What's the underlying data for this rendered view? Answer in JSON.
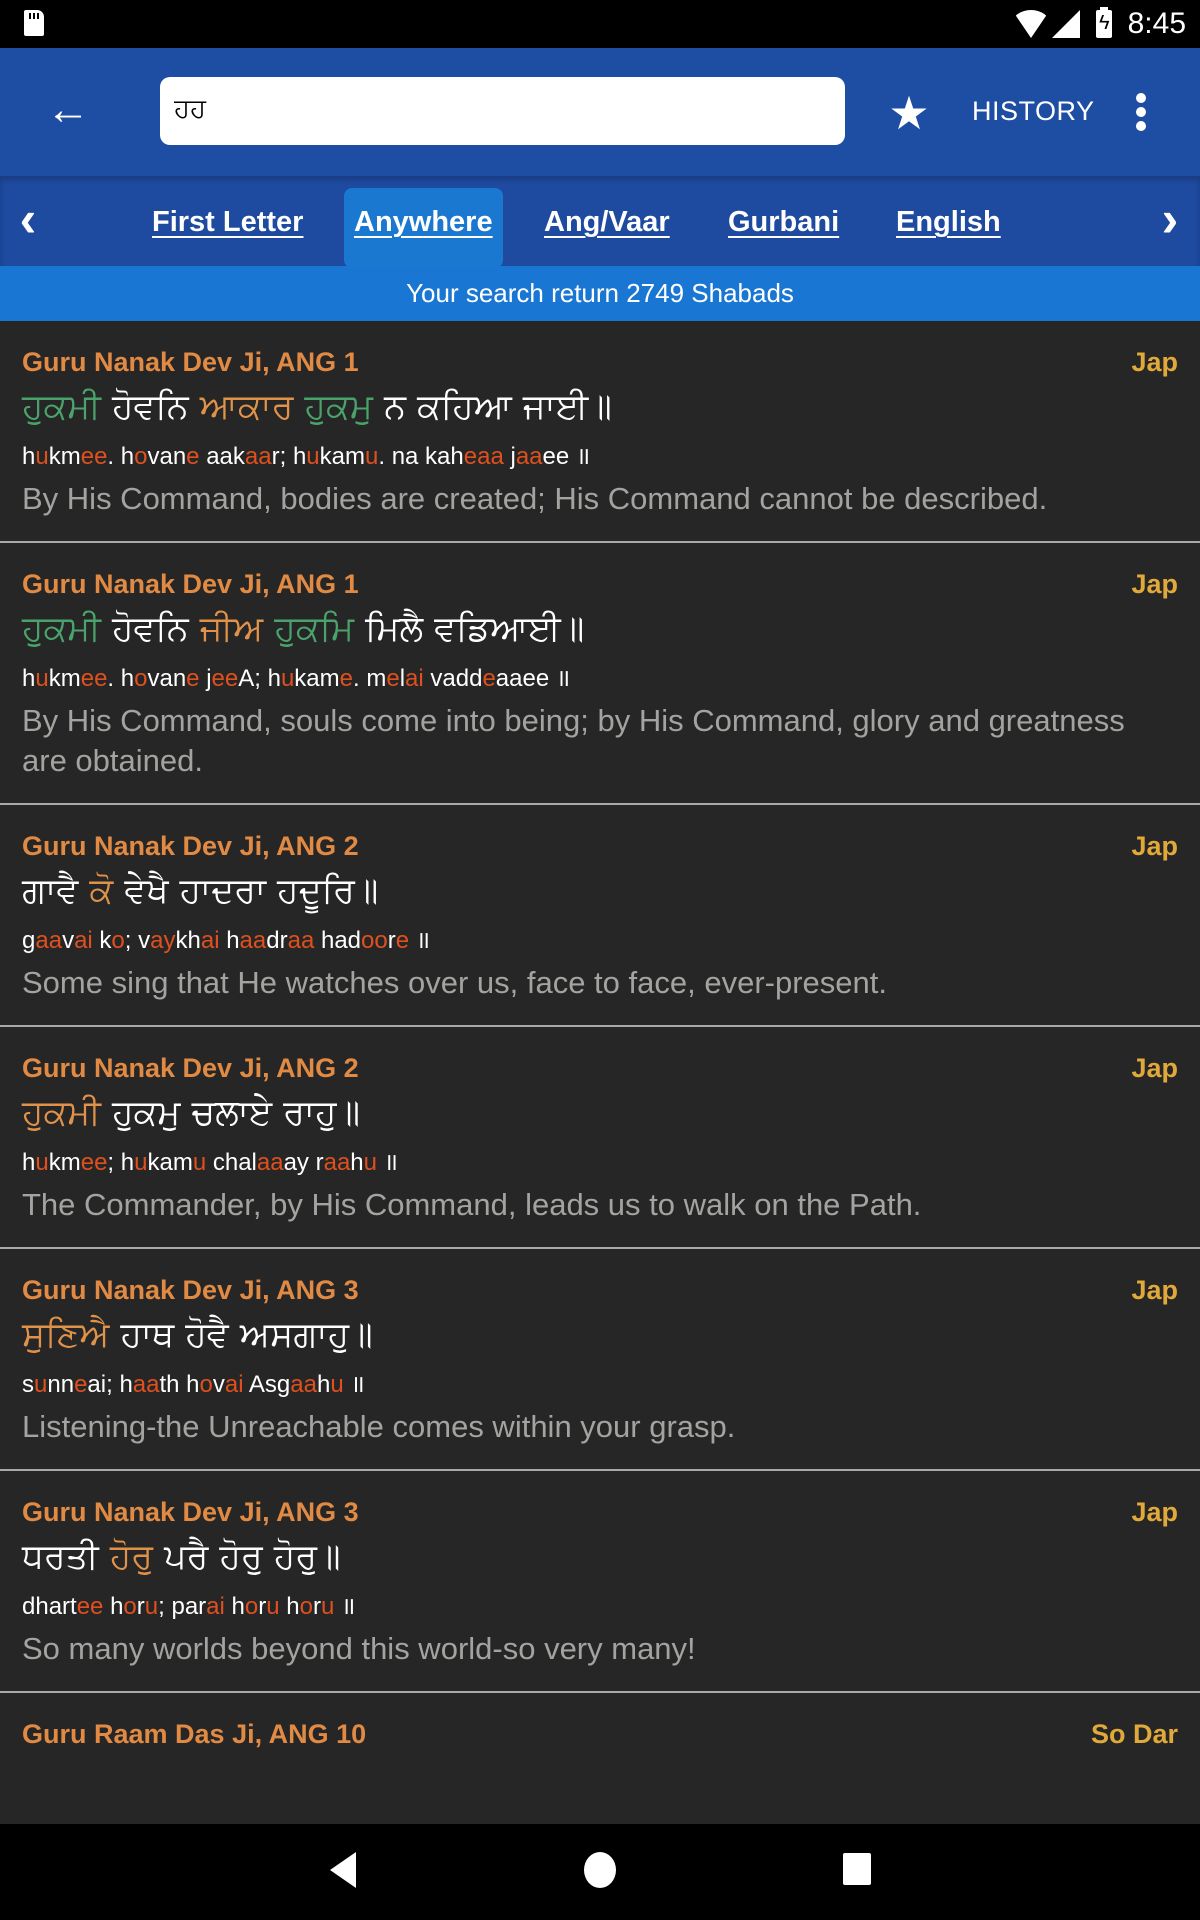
{
  "status_bar": {
    "time": "8:45",
    "icons": [
      "sd-card-icon",
      "wifi-icon",
      "signal-icon",
      "battery-charging-icon"
    ]
  },
  "toolbar": {
    "back_icon": "arrow-left-icon",
    "search_value": "ਹਹ",
    "search_placeholder": "",
    "favorite_icon": "star-icon",
    "history_label": "HISTORY",
    "more_icon": "more-vert-icon"
  },
  "tabs": {
    "prev_icon": "chevron-left-icon",
    "next_icon": "chevron-right-icon",
    "items": [
      {
        "label": "First Letter",
        "active": false
      },
      {
        "label": "Anywhere",
        "active": true
      },
      {
        "label": "Ang/Vaar",
        "active": false
      },
      {
        "label": "Gurbani",
        "active": false
      },
      {
        "label": "English",
        "active": false
      }
    ]
  },
  "banner": {
    "text": "Your search return 2749 Shabads"
  },
  "colors": {
    "toolbar": "#1e4ea4",
    "tabbar": "#1e4aa0",
    "active_tab": "#1a78d0",
    "banner": "#1976d2",
    "background": "#262626",
    "author": "#e08a44",
    "raag": "#e0a93a",
    "gurmukhi_match_green": "#4aa36b",
    "gurmukhi_match_orange": "#e0924a",
    "translit_highlight": "#e0501e",
    "translation": "#a3a3a0"
  },
  "results": [
    {
      "author": "Guru Nanak Dev Ji, ANG 1",
      "raag": "Jap",
      "gurmukhi": [
        {
          "t": "ਹੁਕਮੀ",
          "c": "g"
        },
        {
          "t": " ਹੋਵਨਿ ",
          "c": ""
        },
        {
          "t": "ਆਕਾਰ",
          "c": "o"
        },
        {
          "t": " ",
          "c": ""
        },
        {
          "t": "ਹੁਕਮੁ",
          "c": "g"
        },
        {
          "t": " ਨ ਕਹਿਆ ਜਾਈ॥",
          "c": ""
        }
      ],
      "translit": [
        {
          "t": "h",
          "h": false
        },
        {
          "t": "u",
          "h": true
        },
        {
          "t": "km",
          "h": false
        },
        {
          "t": "ee",
          "h": true
        },
        {
          "t": ". h",
          "h": false
        },
        {
          "t": "o",
          "h": true
        },
        {
          "t": "van",
          "h": false
        },
        {
          "t": "e",
          "h": true
        },
        {
          "t": " aak",
          "h": false
        },
        {
          "t": "aa",
          "h": true
        },
        {
          "t": "r; h",
          "h": false
        },
        {
          "t": "u",
          "h": true
        },
        {
          "t": "kam",
          "h": false
        },
        {
          "t": "u",
          "h": true
        },
        {
          "t": ". na kah",
          "h": false
        },
        {
          "t": "eaa",
          "h": true
        },
        {
          "t": " j",
          "h": false
        },
        {
          "t": "aa",
          "h": true
        },
        {
          "t": "ee ॥",
          "h": false
        }
      ],
      "translation": "By His Command, bodies are created; His Command cannot be described."
    },
    {
      "author": "Guru Nanak Dev Ji, ANG 1",
      "raag": "Jap",
      "gurmukhi": [
        {
          "t": "ਹੁਕਮੀ",
          "c": "g"
        },
        {
          "t": " ਹੋਵਨਿ ",
          "c": ""
        },
        {
          "t": "ਜੀਅ",
          "c": "o"
        },
        {
          "t": " ",
          "c": ""
        },
        {
          "t": "ਹੁਕਮਿ",
          "c": "g"
        },
        {
          "t": " ਮਿਲੈ ਵਡਿਆਈ॥",
          "c": ""
        }
      ],
      "translit": [
        {
          "t": "h",
          "h": false
        },
        {
          "t": "u",
          "h": true
        },
        {
          "t": "km",
          "h": false
        },
        {
          "t": "ee",
          "h": true
        },
        {
          "t": ". h",
          "h": false
        },
        {
          "t": "o",
          "h": true
        },
        {
          "t": "van",
          "h": false
        },
        {
          "t": "e",
          "h": true
        },
        {
          "t": " j",
          "h": false
        },
        {
          "t": "ee",
          "h": true
        },
        {
          "t": "A; h",
          "h": false
        },
        {
          "t": "u",
          "h": true
        },
        {
          "t": "kam",
          "h": false
        },
        {
          "t": "e",
          "h": true
        },
        {
          "t": ". m",
          "h": false
        },
        {
          "t": "e",
          "h": true
        },
        {
          "t": "l",
          "h": false
        },
        {
          "t": "ai",
          "h": true
        },
        {
          "t": " vadd",
          "h": false
        },
        {
          "t": "e",
          "h": true
        },
        {
          "t": "aaee ॥",
          "h": false
        }
      ],
      "translation": "By His Command, souls come into being; by His Command, glory and greatness are obtained."
    },
    {
      "author": "Guru Nanak Dev Ji, ANG 2",
      "raag": "Jap",
      "gurmukhi": [
        {
          "t": "ਗਾਵੈ ",
          "c": ""
        },
        {
          "t": "ਕੋ",
          "c": "o"
        },
        {
          "t": " ਵੇਖੈ ਹਾਦਰਾ ਹਦੂਰਿ॥",
          "c": ""
        }
      ],
      "translit": [
        {
          "t": "g",
          "h": false
        },
        {
          "t": "aa",
          "h": true
        },
        {
          "t": "v",
          "h": false
        },
        {
          "t": "ai",
          "h": true
        },
        {
          "t": " k",
          "h": false
        },
        {
          "t": "o",
          "h": true
        },
        {
          "t": "; v",
          "h": false
        },
        {
          "t": "ay",
          "h": true
        },
        {
          "t": "kh",
          "h": false
        },
        {
          "t": "ai",
          "h": true
        },
        {
          "t": " h",
          "h": false
        },
        {
          "t": "aa",
          "h": true
        },
        {
          "t": "dr",
          "h": false
        },
        {
          "t": "aa",
          "h": true
        },
        {
          "t": " had",
          "h": false
        },
        {
          "t": "oo",
          "h": true
        },
        {
          "t": "r",
          "h": false
        },
        {
          "t": "e",
          "h": true
        },
        {
          "t": " ॥",
          "h": false
        }
      ],
      "translation": "Some sing that He watches over us, face to face, ever-present."
    },
    {
      "author": "Guru Nanak Dev Ji, ANG 2",
      "raag": "Jap",
      "gurmukhi": [
        {
          "t": "ਹੁਕਮੀ",
          "c": "o"
        },
        {
          "t": " ਹੁਕਮੁ ਚਲਾਏ ਰਾਹੁ॥",
          "c": ""
        }
      ],
      "translit": [
        {
          "t": "h",
          "h": false
        },
        {
          "t": "u",
          "h": true
        },
        {
          "t": "km",
          "h": false
        },
        {
          "t": "ee",
          "h": true
        },
        {
          "t": "; h",
          "h": false
        },
        {
          "t": "u",
          "h": true
        },
        {
          "t": "kam",
          "h": false
        },
        {
          "t": "u",
          "h": true
        },
        {
          "t": " chal",
          "h": false
        },
        {
          "t": "aa",
          "h": true
        },
        {
          "t": "ay r",
          "h": false
        },
        {
          "t": "aa",
          "h": true
        },
        {
          "t": "h",
          "h": false
        },
        {
          "t": "u",
          "h": true
        },
        {
          "t": " ॥",
          "h": false
        }
      ],
      "translation": "The Commander, by His Command, leads us to walk on the Path."
    },
    {
      "author": "Guru Nanak Dev Ji, ANG 3",
      "raag": "Jap",
      "gurmukhi": [
        {
          "t": "ਸੁਣਿਐ",
          "c": "o"
        },
        {
          "t": " ਹਾਥ ਹੋਵੈ ਅਸਗਾਹੁ॥",
          "c": ""
        }
      ],
      "translit": [
        {
          "t": "s",
          "h": false
        },
        {
          "t": "u",
          "h": true
        },
        {
          "t": "nn",
          "h": false
        },
        {
          "t": "e",
          "h": true
        },
        {
          "t": "ai; h",
          "h": false
        },
        {
          "t": "aa",
          "h": true
        },
        {
          "t": "th h",
          "h": false
        },
        {
          "t": "o",
          "h": true
        },
        {
          "t": "v",
          "h": false
        },
        {
          "t": "ai",
          "h": true
        },
        {
          "t": " Asg",
          "h": false
        },
        {
          "t": "aa",
          "h": true
        },
        {
          "t": "h",
          "h": false
        },
        {
          "t": "u",
          "h": true
        },
        {
          "t": " ॥",
          "h": false
        }
      ],
      "translation": "Listening-the Unreachable comes within your grasp."
    },
    {
      "author": "Guru Nanak Dev Ji, ANG 3",
      "raag": "Jap",
      "gurmukhi": [
        {
          "t": "ਧਰਤੀ ",
          "c": ""
        },
        {
          "t": "ਹੋਰੁ",
          "c": "o"
        },
        {
          "t": " ਪਰੈ ਹੋਰੁ ਹੋਰੁ॥",
          "c": ""
        }
      ],
      "translit": [
        {
          "t": "dhart",
          "h": false
        },
        {
          "t": "ee",
          "h": true
        },
        {
          "t": " h",
          "h": false
        },
        {
          "t": "o",
          "h": true
        },
        {
          "t": "r",
          "h": false
        },
        {
          "t": "u",
          "h": true
        },
        {
          "t": "; par",
          "h": false
        },
        {
          "t": "ai",
          "h": true
        },
        {
          "t": " h",
          "h": false
        },
        {
          "t": "o",
          "h": true
        },
        {
          "t": "r",
          "h": false
        },
        {
          "t": "u",
          "h": true
        },
        {
          "t": " h",
          "h": false
        },
        {
          "t": "o",
          "h": true
        },
        {
          "t": "r",
          "h": false
        },
        {
          "t": "u",
          "h": true
        },
        {
          "t": " ॥",
          "h": false
        }
      ],
      "translation": "So many worlds beyond this world-so very many!"
    },
    {
      "author": "Guru Raam Das Ji, ANG 10",
      "raag": "So Dar",
      "gurmukhi": [],
      "translit": [],
      "translation": ""
    }
  ],
  "nav_bar": {
    "icons": [
      "nav-back-icon",
      "nav-home-icon",
      "nav-recents-icon"
    ]
  }
}
